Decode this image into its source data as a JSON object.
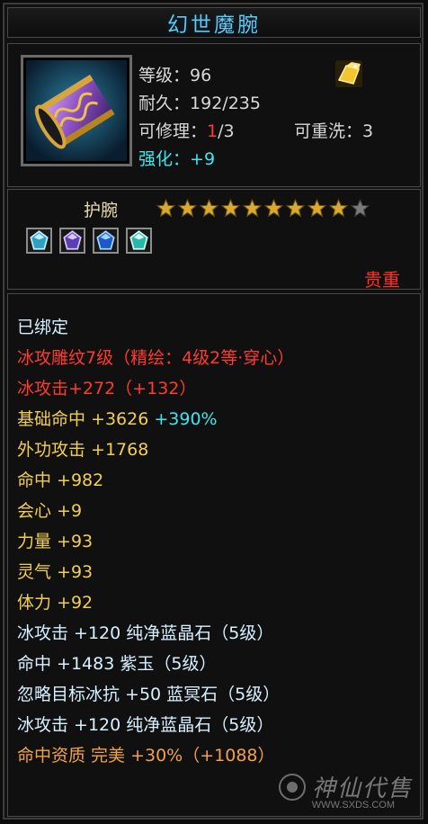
{
  "title": "幻世魔腕",
  "item_icon": "bracer-item-icon",
  "stats": {
    "level_label": "等级",
    "level_value": "96",
    "durability_label": "耐久",
    "durability_value": "192/235",
    "repair_label": "可修理",
    "repair_used": "1",
    "repair_max": "/3",
    "reforge_label": "可重洗",
    "reforge_value": "3",
    "enhance_label": "强化",
    "enhance_value": "+9"
  },
  "equipment_type": "护腕",
  "stars": {
    "filled": 9,
    "total": 10,
    "icon": "star-icon"
  },
  "gems": [
    "blue-gem-icon",
    "purple-gem-icon",
    "blue-crystal-gem-icon",
    "cyan-gem-icon"
  ],
  "rarity": "贵重",
  "attributes": [
    {
      "text": "已绑定",
      "color": "white"
    },
    {
      "text": "冰攻雕纹7级（精绘：4级2等·穿心）",
      "color": "red"
    },
    {
      "text": "冰攻击+272（+132）",
      "color": "red"
    },
    {
      "text": "基础命中 +3626",
      "extra": " +390%",
      "color": "yellow"
    },
    {
      "text": "外功攻击 +1768",
      "color": "yellow"
    },
    {
      "text": "命中 +982",
      "color": "yellow"
    },
    {
      "text": "会心 +9",
      "color": "yellow"
    },
    {
      "text": "力量 +93",
      "color": "yellow"
    },
    {
      "text": "灵气 +93",
      "color": "yellow"
    },
    {
      "text": "体力 +92",
      "color": "yellow"
    },
    {
      "text": "冰攻击 +120 纯净蓝晶石（5级）",
      "color": "white"
    },
    {
      "text": "命中 +1483 紫玉（5级）",
      "color": "white"
    },
    {
      "text": "忽略目标冰抗 +50 蓝冥石（5级）",
      "color": "white"
    },
    {
      "text": "冰攻击 +120 纯净蓝晶石（5级）",
      "color": "white"
    },
    {
      "text": "命中资质  完美 +30%（+1088）",
      "color": "orange"
    }
  ],
  "watermark": {
    "text": "神仙代售",
    "url": "WWW.SXDS.COM"
  }
}
